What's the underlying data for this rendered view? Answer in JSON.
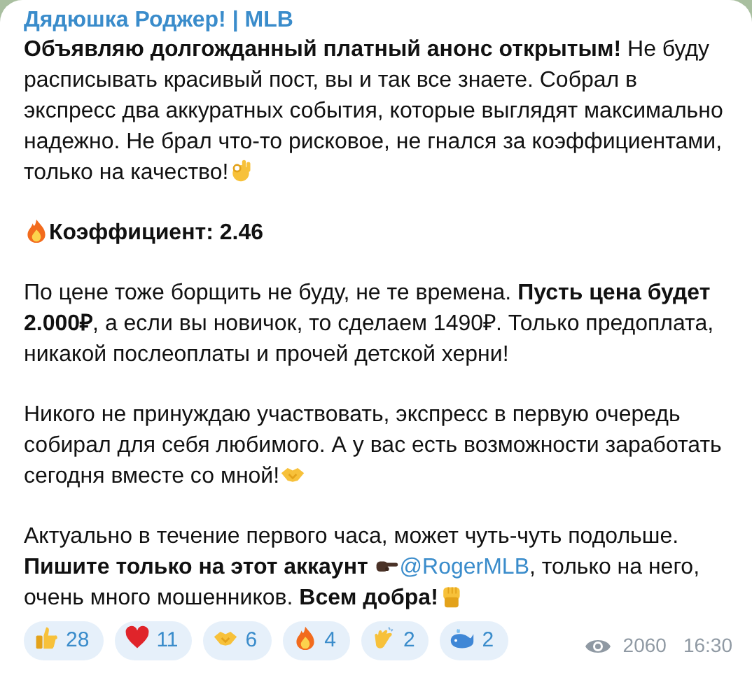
{
  "channel": {
    "title": "Дядюшка Роджер! | MLB"
  },
  "paragraphs": [
    {
      "runs": [
        {
          "kind": "text",
          "text": "**Объявляю долгожданный платный анонс открытым!** Не буду расписывать красивый пост, вы и так все знаете. Собрал в экспресс два аккуратных события, которые выглядят максимально надежно. Не брал что-то рисковое, не гнался за коэффициентами, только на качество!"
        },
        {
          "kind": "emoji"
        }
      ]
    },
    {
      "runs": [
        {
          "kind": "emoji"
        },
        {
          "kind": "text",
          "text": "Коэффициент: 2.46",
          "bold": true
        }
      ]
    },
    {
      "runs": [
        {
          "kind": "text",
          "text": "По цене тоже борщить не буду, не те времена. **Пусть цена будет 2.000₽**, а если вы новичок, то сделаем 1490₽. Только предоплата, никакой послеоплаты и прочей детской херни!"
        }
      ]
    },
    {
      "runs": [
        {
          "kind": "text",
          "text": "Никого не принуждаю участвовать, экспресс в первую очередь собирал для себя любимого. А у вас есть возможности заработать сегодня вместе со мной!"
        },
        {
          "kind": "emoji"
        }
      ]
    },
    {
      "runs": [
        {
          "kind": "text",
          "text": "Актуально в течение первого часа, может чуть-чуть подольше. **Пишите только на этот аккаунт** "
        },
        {
          "kind": "emoji"
        },
        {
          "kind": "link",
          "text": "@RogerMLB"
        },
        {
          "kind": "text",
          "text": ", только на него, очень много мошенников. **Всем добра!**"
        },
        {
          "kind": "emoji"
        }
      ]
    }
  ],
  "reactions": [
    {
      "count": "28",
      "selected": false
    },
    {
      "count": "11",
      "selected": false
    },
    {
      "count": "6",
      "selected": false
    },
    {
      "count": "4",
      "selected": false
    },
    {
      "count": "2",
      "selected": false
    },
    {
      "count": "2",
      "selected": false
    }
  ],
  "views": "2060",
  "time": "16:30"
}
